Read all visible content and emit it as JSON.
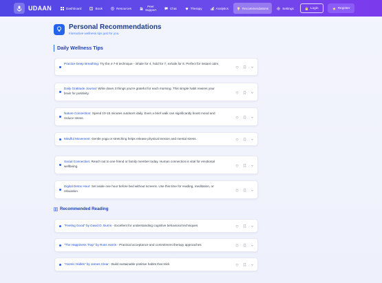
{
  "app": {
    "name": "UDAAN"
  },
  "nav": {
    "items": [
      {
        "label": "Dashboard",
        "icon": "dashboard-icon"
      },
      {
        "label": "Book",
        "icon": "book-icon"
      },
      {
        "label": "Resources",
        "icon": "resources-icon"
      },
      {
        "label": "Peer",
        "label2": "Support",
        "icon": "peer-support-icon"
      },
      {
        "label": "Chat",
        "icon": "chat-icon"
      },
      {
        "label": "Therapy",
        "icon": "therapy-icon"
      },
      {
        "label": "Analytics",
        "icon": "analytics-icon"
      },
      {
        "label": "Recommendations",
        "icon": "lightbulb-icon",
        "active": true
      },
      {
        "label": "Settings",
        "icon": "gear-icon"
      }
    ],
    "login_label": "Login",
    "register_label": "Register"
  },
  "header": {
    "title": "Personal Recommendations",
    "subtitle": "Interactive wellness tips just for you."
  },
  "wellness": {
    "heading": "Daily Wellness Tips",
    "tips": [
      {
        "title": "Practice Deep Breathing:",
        "text": " Try the 4-7-8 technique - inhale for 4, hold for 7, exhale for 8. Perfect for instant calm."
      },
      {
        "title": "Daily Gratitude Journal:",
        "text": " Write down 3 things you're grateful for each morning. This simple habit rewires your brain for positivity."
      },
      {
        "title": "Nature Connection:",
        "text": " Spend 10-15 minutes outdoors daily. Even a brief walk can significantly boost mood and reduce stress."
      },
      {
        "title": "Mindful Movement:",
        "text": " Gentle yoga or stretching helps release physical tension and mental stress."
      },
      {
        "title": "Social Connection:",
        "text": " Reach out to one friend or family member today. Human connection is vital for emotional wellbeing."
      },
      {
        "title": "Digital Detox Hour:",
        "text": " Set aside one hour before bed without screens. Use this time for reading, meditation, or relaxation."
      }
    ]
  },
  "reading": {
    "heading": "Recommended Reading",
    "books": [
      {
        "title": "\"Feeling Good\" by David D. Burns",
        "text": " - Excellent for understanding cognitive behavioral techniques"
      },
      {
        "title": "\"The Happiness Trap\" by Russ Harris",
        "text": " - Practical acceptance and commitment therapy approaches"
      },
      {
        "title": "\"Atomic Habits\" by James Clear",
        "text": " - Build sustainable positive habits that stick"
      }
    ]
  },
  "colors": {
    "nav_start": "#4f46e5",
    "nav_end": "#7c3aed",
    "accent": "#2563eb",
    "title": "#1e3a8a"
  }
}
